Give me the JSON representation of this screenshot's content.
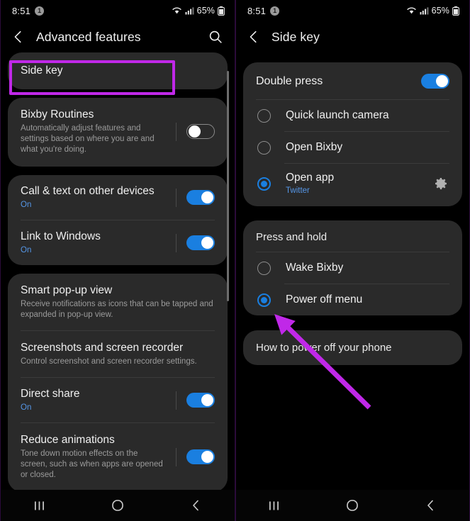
{
  "annotation": {
    "highlight_color": "#c028e8",
    "arrow_color": "#c028e8",
    "highlight_target": "Side key",
    "arrow_target": "Power off menu"
  },
  "left_panel": {
    "statusbar": {
      "time": "8:51",
      "notification_badge": "1",
      "battery_percent": "65%",
      "icons": [
        "wifi-icon",
        "cellular-signal-icon",
        "battery-icon"
      ]
    },
    "appbar": {
      "back_icon": "chevron-left-icon",
      "title": "Advanced features",
      "search_icon": "search-icon"
    },
    "items": [
      {
        "title": "Side key",
        "sub": "",
        "control": "none"
      },
      {
        "title": "Bixby Routines",
        "sub": "Automatically adjust features and settings based on where you are and what you're doing.",
        "control": "toggle",
        "toggle_on": false
      },
      {
        "title": "Call & text on other devices",
        "sub": "On",
        "sub_blue": true,
        "control": "toggle",
        "toggle_on": true
      },
      {
        "title": "Link to Windows",
        "sub": "On",
        "sub_blue": true,
        "control": "toggle",
        "toggle_on": true
      },
      {
        "title": "Smart pop-up view",
        "sub": "Receive notifications as icons that can be tapped and expanded in pop-up view.",
        "control": "none"
      },
      {
        "title": "Screenshots and screen recorder",
        "sub": "Control screenshot and screen recorder settings.",
        "control": "none"
      },
      {
        "title": "Direct share",
        "sub": "On",
        "sub_blue": true,
        "control": "toggle",
        "toggle_on": true
      },
      {
        "title": "Reduce animations",
        "sub": "Tone down motion effects on the screen, such as when apps are opened or closed.",
        "control": "toggle",
        "toggle_on": true
      }
    ],
    "navbar": [
      "recents-icon",
      "home-icon",
      "back-icon"
    ]
  },
  "right_panel": {
    "statusbar": {
      "time": "8:51",
      "notification_badge": "1",
      "battery_percent": "65%",
      "icons": [
        "wifi-icon",
        "cellular-signal-icon",
        "battery-icon"
      ]
    },
    "appbar": {
      "back_icon": "chevron-left-icon",
      "title": "Side key"
    },
    "double_press": {
      "header": "Double press",
      "toggle_on": true,
      "options": [
        {
          "label": "Quick launch camera",
          "sub": "",
          "selected": false,
          "has_gear": false
        },
        {
          "label": "Open Bixby",
          "sub": "",
          "selected": false,
          "has_gear": false
        },
        {
          "label": "Open app",
          "sub": "Twitter",
          "selected": true,
          "has_gear": true
        }
      ]
    },
    "press_and_hold": {
      "header": "Press and hold",
      "options": [
        {
          "label": "Wake Bixby",
          "selected": false
        },
        {
          "label": "Power off menu",
          "selected": true
        }
      ]
    },
    "help_link": "How to power off your phone",
    "navbar": [
      "recents-icon",
      "home-icon",
      "back-icon"
    ]
  }
}
